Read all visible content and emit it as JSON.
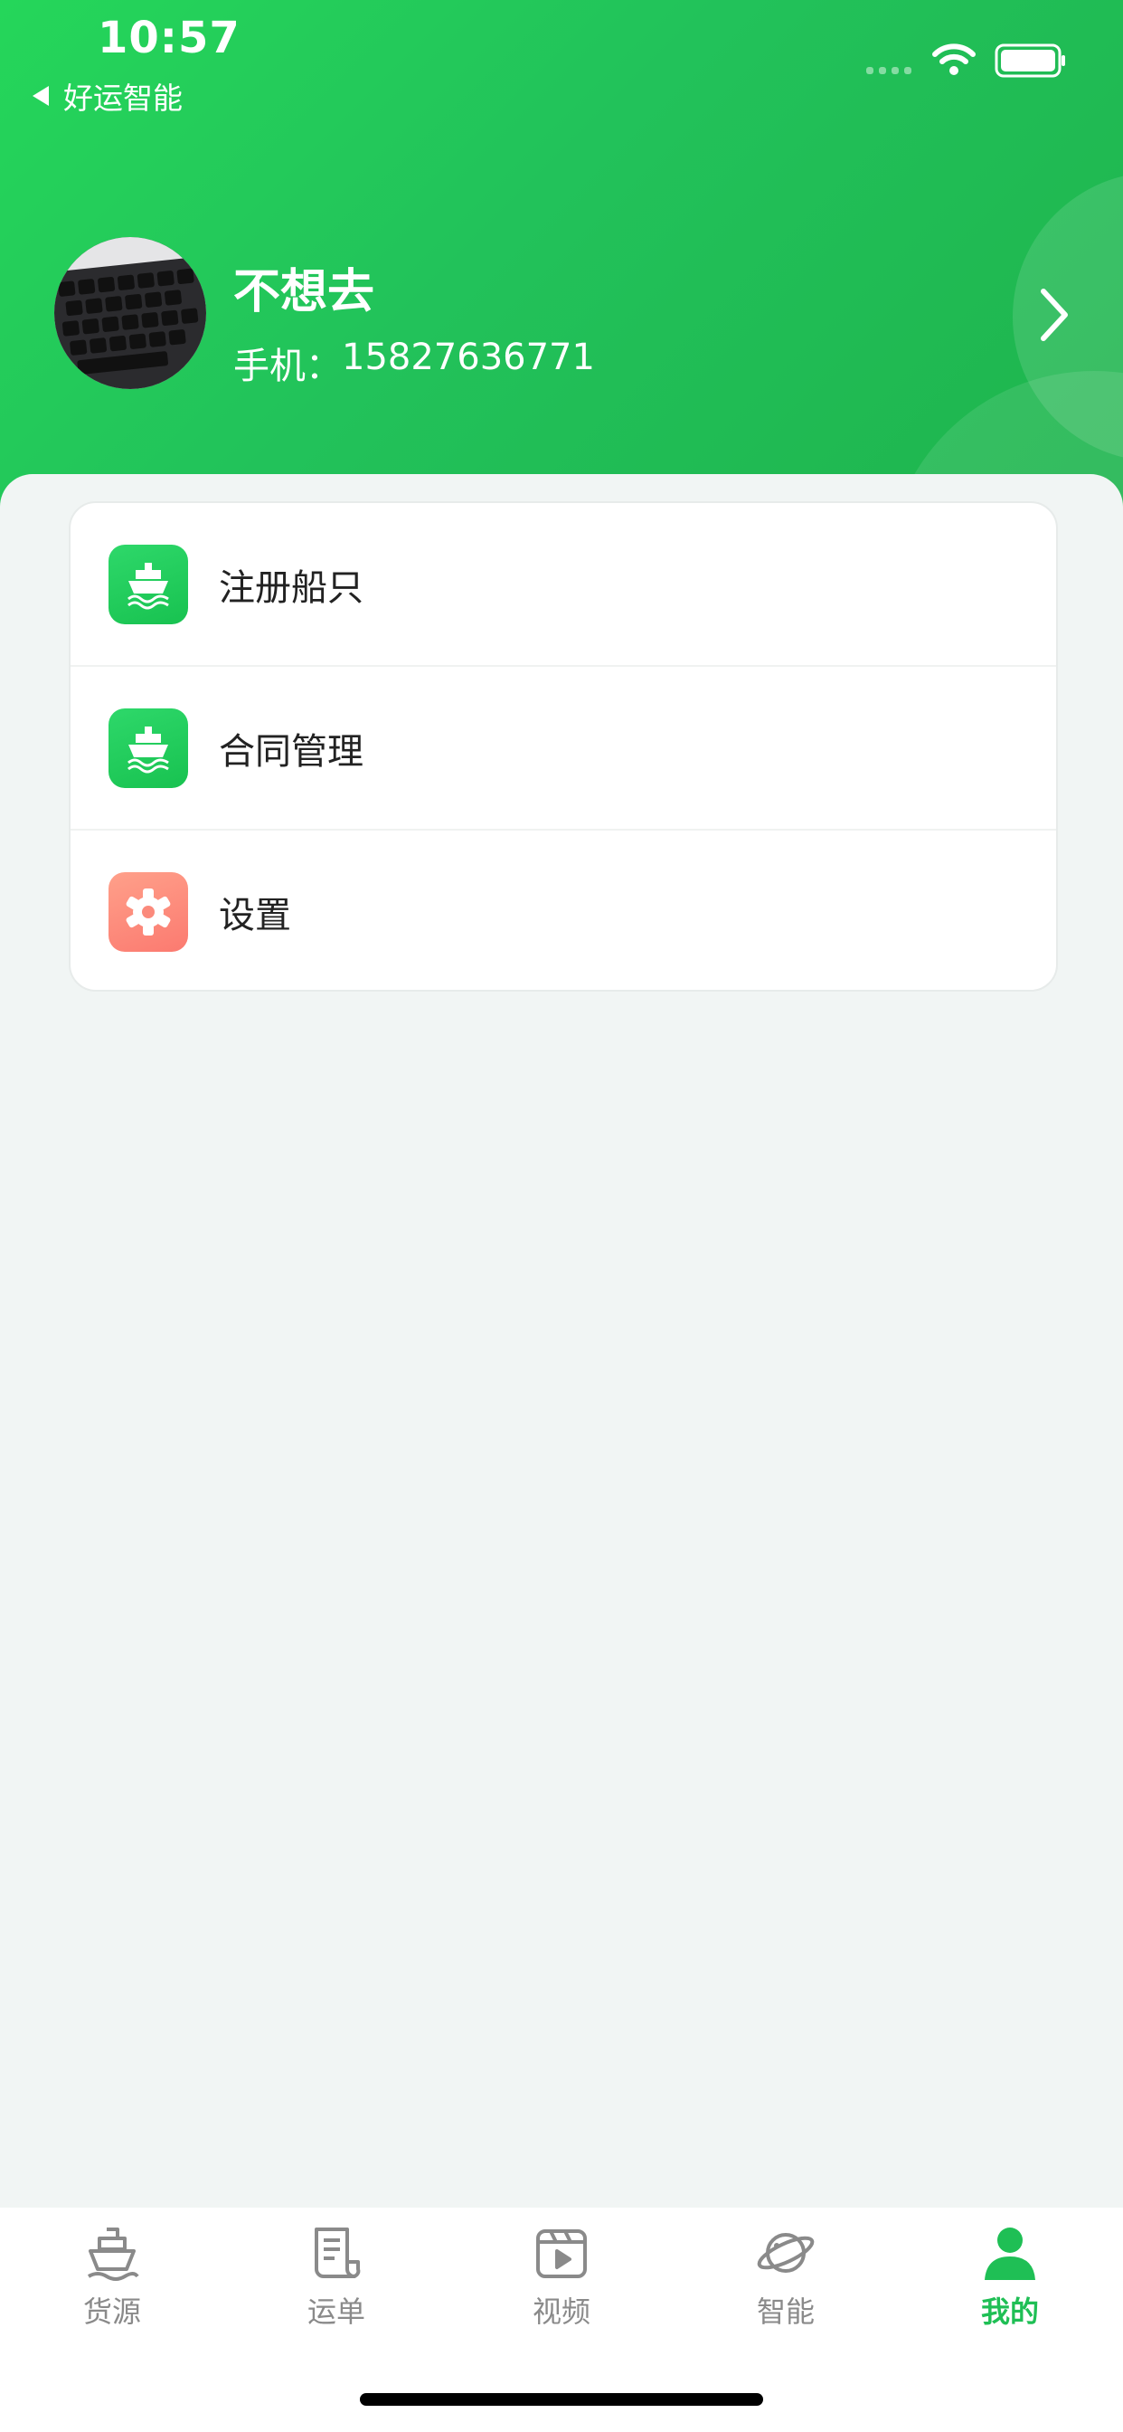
{
  "status_bar": {
    "time": "10:57",
    "back_app": "好运智能"
  },
  "profile": {
    "name": "不想去",
    "phone_label": "手机：",
    "phone": "15827636771"
  },
  "menu": {
    "items": [
      {
        "label": "注册船只",
        "icon": "ship-icon",
        "color": "#1fc855"
      },
      {
        "label": "合同管理",
        "icon": "ship-icon",
        "color": "#1fc855"
      },
      {
        "label": "设置",
        "icon": "gear-icon",
        "color": "#fb7a70"
      }
    ]
  },
  "tabbar": {
    "items": [
      {
        "label": "货源",
        "icon": "ship-icon"
      },
      {
        "label": "运单",
        "icon": "document-icon"
      },
      {
        "label": "视频",
        "icon": "video-icon"
      },
      {
        "label": "智能",
        "icon": "planet-icon"
      },
      {
        "label": "我的",
        "icon": "person-icon"
      }
    ],
    "active": "我的",
    "active_color": "#1fbf55"
  },
  "colors": {
    "header_green": "#22c25a",
    "background": "#f1f5f4"
  }
}
